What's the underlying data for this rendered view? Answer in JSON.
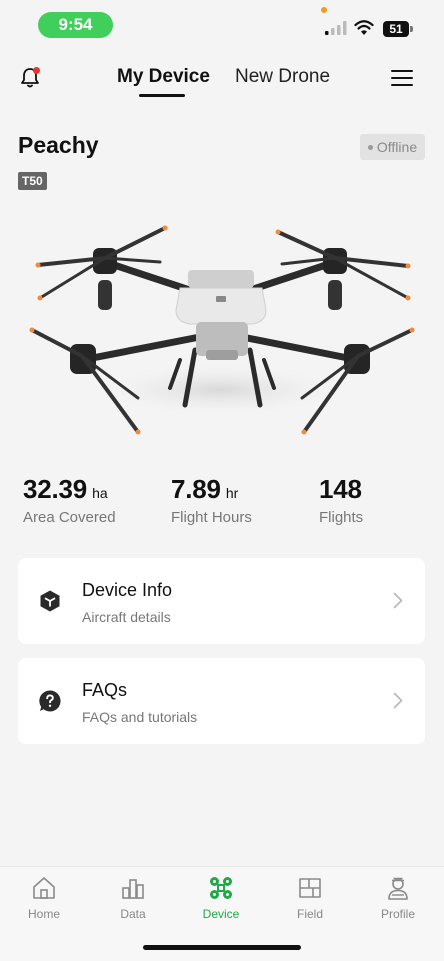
{
  "status_bar": {
    "time": "9:54",
    "battery": "51"
  },
  "header": {
    "tabs": [
      {
        "label": "My Device",
        "active": true
      },
      {
        "label": "New Drone",
        "active": false
      }
    ],
    "icons": [
      "bell-icon",
      "menu-icon"
    ]
  },
  "device": {
    "name": "Peachy",
    "model": "T50",
    "status": "Offline",
    "image": "agricultural-drone-image"
  },
  "stats": [
    {
      "value": "32.39",
      "unit": "ha",
      "label": "Area Covered"
    },
    {
      "value": "7.89",
      "unit": "hr",
      "label": "Flight Hours"
    },
    {
      "value": "148",
      "unit": "",
      "label": "Flights"
    }
  ],
  "cards": [
    {
      "title": "Device Info",
      "subtitle": "Aircraft details",
      "icon": "cube-icon"
    },
    {
      "title": "FAQs",
      "subtitle": "FAQs and tutorials",
      "icon": "question-bubble-icon"
    }
  ],
  "tabbar": {
    "items": [
      {
        "label": "Home",
        "icon": "home-icon",
        "active": false
      },
      {
        "label": "Data",
        "icon": "bar-chart-icon",
        "active": false
      },
      {
        "label": "Device",
        "icon": "drone-icon",
        "active": true
      },
      {
        "label": "Field",
        "icon": "field-map-icon",
        "active": false
      },
      {
        "label": "Profile",
        "icon": "profile-icon",
        "active": false
      }
    ]
  },
  "colors": {
    "accent": "#22a84a",
    "time_pill": "#3fcf5a",
    "notification_dot": "#e8352b",
    "background": "#f4f4f4"
  }
}
